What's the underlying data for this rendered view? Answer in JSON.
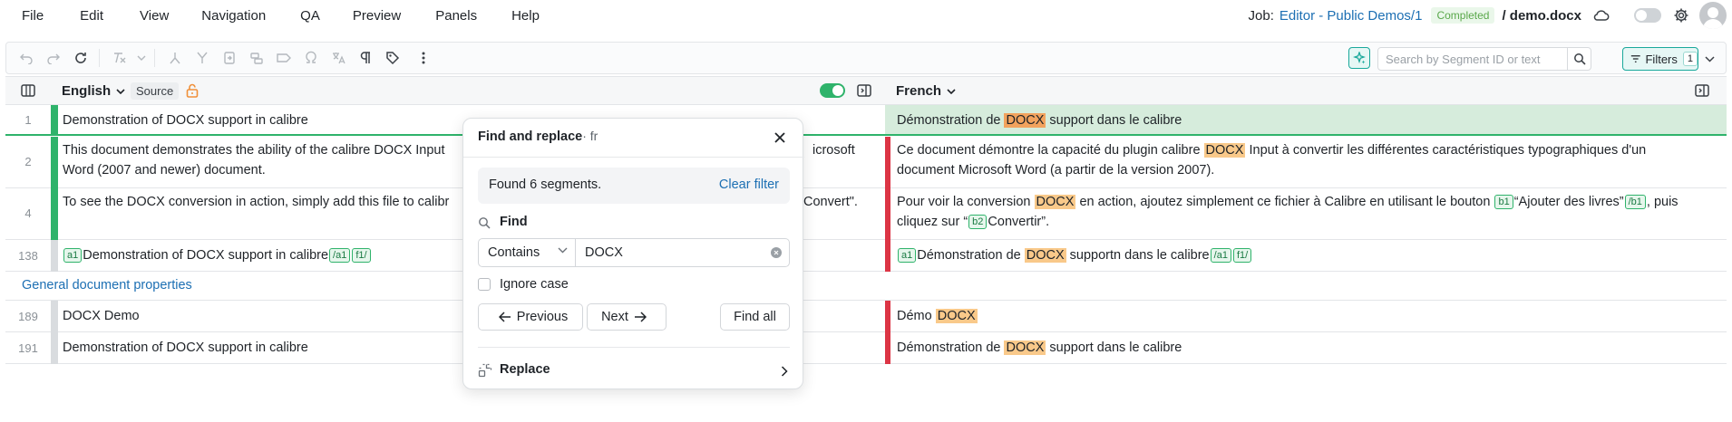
{
  "menu": {
    "items": [
      {
        "label": "File"
      },
      {
        "label": "Edit"
      },
      {
        "label": "View"
      },
      {
        "label": "Navigation"
      },
      {
        "label": "QA"
      },
      {
        "label": "Preview"
      },
      {
        "label": "Panels"
      },
      {
        "label": "Help"
      }
    ]
  },
  "job": {
    "label": "Job:",
    "link": "Editor - Public Demos/1",
    "status": "Completed",
    "document": "/ demo.docx"
  },
  "toolbar": {
    "search_placeholder": "Search by Segment ID or text",
    "filters_label": "Filters",
    "filters_count": "1"
  },
  "columns": {
    "source_lang": "English",
    "source_badge": "Source",
    "target_lang": "French"
  },
  "rows": [
    {
      "num": "1",
      "source": "Demonstration of DOCX support in calibre",
      "target_pre": "Démonstration de ",
      "target_hl": "DOCX",
      "target_post": " support dans le calibre"
    },
    {
      "num": "2",
      "source_l1": "This document demonstrates the ability of the calibre DOCX Input",
      "source_r1": "icrosoft",
      "source_l2": "Word (2007 and newer) document.",
      "target_pre": "Ce document démontre la capacité du plugin calibre ",
      "target_hl": "DOCX",
      "target_post": " Input à convertir les différentes caractéristiques typographiques d'un",
      "target_line2": "document Microsoft Word (a partir de la version 2007)."
    },
    {
      "num": "4",
      "source_l1": "To see the DOCX conversion in action, simply add this file to calibr",
      "source_r1": "Convert\".",
      "target_pre": "Pour voir la conversion ",
      "target_hl": "DOCX",
      "target_post": " en action, ajoutez simplement ce fichier à Calibre en utilisant le bouton ",
      "tag_b1": "b1",
      "target_quote": "“Ajouter des livres”",
      "tag_b1_close": "/b1",
      "target_end": ", puis",
      "target_line2_pre": "cliquez sur “",
      "tag_b2": "b2",
      "target_line2_post": "Convertir”."
    },
    {
      "num": "138",
      "tag_a1": "a1",
      "source": "Demonstration of DOCX support in calibre",
      "tag_a1_close": "/a1",
      "tag_f1": "f1/",
      "target_pre": "Démonstration de ",
      "target_hl": "DOCX",
      "target_post": " supportn dans le calibre"
    },
    {
      "num": "189",
      "source": "DOCX Demo",
      "target_pre": "Démo ",
      "target_hl": "DOCX"
    },
    {
      "num": "191",
      "source": "Demonstration of DOCX support in calibre",
      "target_pre": "Démonstration de ",
      "target_hl": "DOCX",
      "target_post": " support dans le calibre"
    }
  ],
  "section": {
    "label": "General document properties"
  },
  "dialog": {
    "title": "Find and replace",
    "subtitle": "· fr",
    "found_text": "Found 6 segments.",
    "clear_filter": "Clear filter",
    "find_label": "Find",
    "mode": "Contains",
    "find_value": "DOCX",
    "ignore_case": "Ignore case",
    "prev_label": "Previous",
    "next_label": "Next",
    "find_all_label": "Find all",
    "replace_label": "Replace"
  },
  "colors": {
    "accent": "#19a89b",
    "confirmed_bar": "#2fb36b",
    "error_bar": "#dc3545",
    "active_row": "#d6ecdc",
    "highlight": "#f9c98a",
    "link": "#1c6fb3"
  }
}
